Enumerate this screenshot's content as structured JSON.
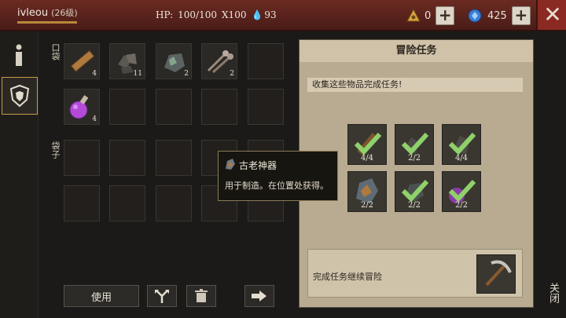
{
  "header": {
    "player_name": "ivleou",
    "player_level": "(26级)",
    "hp_label": "HP:",
    "hp_value": "100/100",
    "multiplier_label": "X100",
    "drop_value": "93",
    "triangle_currency": "0",
    "gem_currency": "425",
    "accent_color": "#c59a46"
  },
  "tabs": {
    "info_icon": "info-icon",
    "shield_icon": "shield-icon"
  },
  "inventory": {
    "pocket_label": "口袋",
    "bag_label": "袋子",
    "pocket_items": [
      {
        "icon": "wood-plank-icon",
        "count": "4"
      },
      {
        "icon": "coal-ore-icon",
        "count": "11"
      },
      {
        "icon": "iron-ore-icon",
        "count": "2"
      },
      {
        "icon": "nails-icon",
        "count": "2"
      },
      {
        "icon": "empty",
        "count": ""
      },
      {
        "icon": "purple-potion-icon",
        "count": "4"
      }
    ],
    "buttons": {
      "use_label": "使用",
      "split_icon": "split-arrow-icon",
      "trash_icon": "trash-icon",
      "move_icon": "arrow-right-icon"
    }
  },
  "quest": {
    "title": "冒险任务",
    "description": "收集这些物品完成任务!",
    "items": [
      {
        "icon": "wood-plank-icon",
        "count": "4/4",
        "done": true
      },
      {
        "icon": "coal-ore-icon",
        "count": "2/2",
        "done": true
      },
      {
        "icon": "coal-ore-icon",
        "count": "4/4",
        "done": true
      },
      {
        "icon": "ancient-artifact-icon",
        "count": "2/2",
        "done": false
      },
      {
        "icon": "iron-ore-icon",
        "count": "2/2",
        "done": true
      },
      {
        "icon": "purple-potion-icon",
        "count": "2/2",
        "done": true
      }
    ],
    "footer_text": "完成任务继续冒险",
    "reward_icon": "pickaxe-icon"
  },
  "tooltip": {
    "title": "古老神器",
    "body": "用于制造。在位置处获得。"
  },
  "side": {
    "close_label": "关闭"
  }
}
